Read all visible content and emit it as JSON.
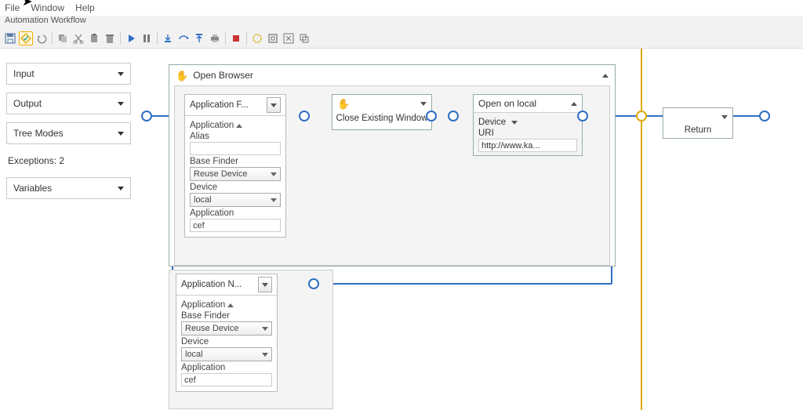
{
  "menu": {
    "file": "File",
    "window": "Window",
    "help": "Help"
  },
  "subheader": "Automation Workflow",
  "sidebar": {
    "input": "Input",
    "output": "Output",
    "tree_modes": "Tree Modes",
    "exceptions": "Exceptions: 2",
    "variables": "Variables"
  },
  "workflow": {
    "open_browser": {
      "title": "Open Browser"
    },
    "app_f": {
      "title": "Application F...",
      "application": "Application",
      "alias": "Alias",
      "alias_value": "",
      "base_finder": "Base Finder",
      "reuse_device": "Reuse Device",
      "device": "Device",
      "device_value": "local",
      "application2": "Application",
      "app_value": "cef"
    },
    "close_existing": {
      "label": "Close Existing Window"
    },
    "open_local": {
      "title": "Open on local",
      "device": "Device",
      "uri_label": "URI",
      "uri_value": "http://www.ka..."
    },
    "return": {
      "label": "Return"
    },
    "app_n": {
      "title": "Application N...",
      "application": "Application",
      "base_finder": "Base Finder",
      "reuse_device": "Reuse Device",
      "device": "Device",
      "device_value": "local",
      "application2": "Application",
      "app_value": "cef"
    }
  }
}
